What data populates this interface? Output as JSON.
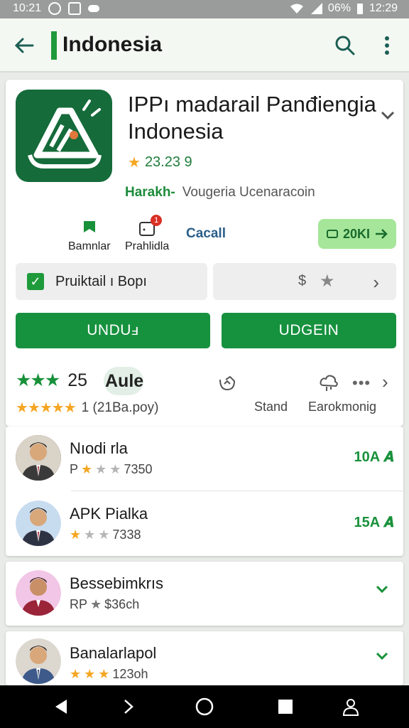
{
  "status_bar": {
    "time_left": "10:21",
    "battery": "06%",
    "time_right": "12:29"
  },
  "app_bar": {
    "title": "Indonesia"
  },
  "app": {
    "name": "IPPı madarail Panđiengia Indonesia",
    "rating": "23.23 9",
    "developer": "Harakh-",
    "description": "Vougeria Ucenaracoin",
    "meta": [
      {
        "label": "Bamnlar",
        "icon": "flag-icon"
      },
      {
        "label": "Prahlidla",
        "icon": "calendar-icon",
        "badge": "1"
      }
    ],
    "cacat_label": "Cacall",
    "size_label": "20KI",
    "option_label": "Pruiktail ı Bopı",
    "price_label": "$",
    "buttons": {
      "unduh": "UNDUⅎ",
      "udgein": "UDGEIN"
    }
  },
  "rating_section": {
    "value": "25",
    "auto_label": "Aule",
    "reviews": "1 (21Ba.poy)",
    "stand_label": "Stand",
    "earok_label": "Earokmonig"
  },
  "list": [
    {
      "name": "Nıodi rla",
      "prefix": "P",
      "sub": "7350",
      "right": "10A 𝑨",
      "stars": 3
    },
    {
      "name": "APK Pialka",
      "prefix": "",
      "sub": "7338",
      "right": "15A 𝑨",
      "stars": 3
    },
    {
      "name": "Bessebimkrıs",
      "prefix": "RP",
      "sub": "$36ch",
      "right": "✓",
      "stars": 1
    },
    {
      "name": "Banalarlapol",
      "prefix": "",
      "sub": "123oh",
      "right": "✓",
      "stars": 3
    }
  ],
  "colors": {
    "accent": "#1e9a3a",
    "brand_dark": "#156b3a",
    "chip": "#a6e69a"
  }
}
